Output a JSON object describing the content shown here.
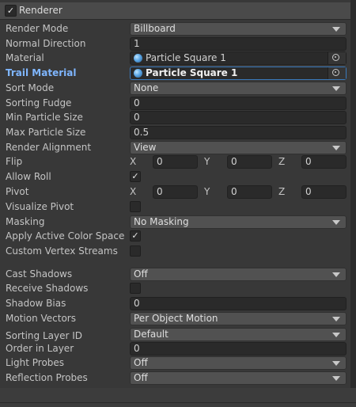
{
  "component": {
    "title": "Renderer",
    "checkmark": "✓"
  },
  "fields": {
    "render_mode": {
      "label": "Render Mode",
      "value": "Billboard"
    },
    "normal_direction": {
      "label": "Normal Direction",
      "value": "1"
    },
    "material": {
      "label": "Material",
      "value": "Particle Square 1"
    },
    "trail_material": {
      "label": "Trail Material",
      "value": "Particle Square 1"
    },
    "sort_mode": {
      "label": "Sort Mode",
      "value": "None"
    },
    "sorting_fudge": {
      "label": "Sorting Fudge",
      "value": "0"
    },
    "min_particle_size": {
      "label": "Min Particle Size",
      "value": "0"
    },
    "max_particle_size": {
      "label": "Max Particle Size",
      "value": "0.5"
    },
    "render_alignment": {
      "label": "Render Alignment",
      "value": "View"
    },
    "flip": {
      "label": "Flip",
      "x_label": "X",
      "x": "0",
      "y_label": "Y",
      "y": "0",
      "z_label": "Z",
      "z": "0"
    },
    "allow_roll": {
      "label": "Allow Roll",
      "checked": "✓"
    },
    "pivot": {
      "label": "Pivot",
      "x_label": "X",
      "x": "0",
      "y_label": "Y",
      "y": "0",
      "z_label": "Z",
      "z": "0"
    },
    "visualize_pivot": {
      "label": "Visualize Pivot"
    },
    "masking": {
      "label": "Masking",
      "value": "No Masking"
    },
    "apply_active_color_space": {
      "label": "Apply Active Color Space",
      "checked": "✓"
    },
    "custom_vertex_streams": {
      "label": "Custom Vertex Streams"
    },
    "cast_shadows": {
      "label": "Cast Shadows",
      "value": "Off"
    },
    "receive_shadows": {
      "label": "Receive Shadows"
    },
    "shadow_bias": {
      "label": "Shadow Bias",
      "value": "0"
    },
    "motion_vectors": {
      "label": "Motion Vectors",
      "value": "Per Object Motion"
    },
    "sorting_layer_id": {
      "label": "Sorting Layer ID",
      "value": "Default"
    },
    "order_in_layer": {
      "label": "Order in Layer",
      "value": "0"
    },
    "light_probes": {
      "label": "Light Probes",
      "value": "Off"
    },
    "reflection_probes": {
      "label": "Reflection Probes",
      "value": "Off"
    }
  },
  "icons": {
    "material_dot": "material-sphere-icon",
    "object_picker": "object-picker-icon",
    "dropdown": "chevron-down-icon"
  },
  "colors": {
    "panel": "#383838",
    "field": "#2a2a2a",
    "dropdown": "#515151",
    "highlight_label": "#7fb6ff",
    "highlight_border": "#3a79bb"
  }
}
